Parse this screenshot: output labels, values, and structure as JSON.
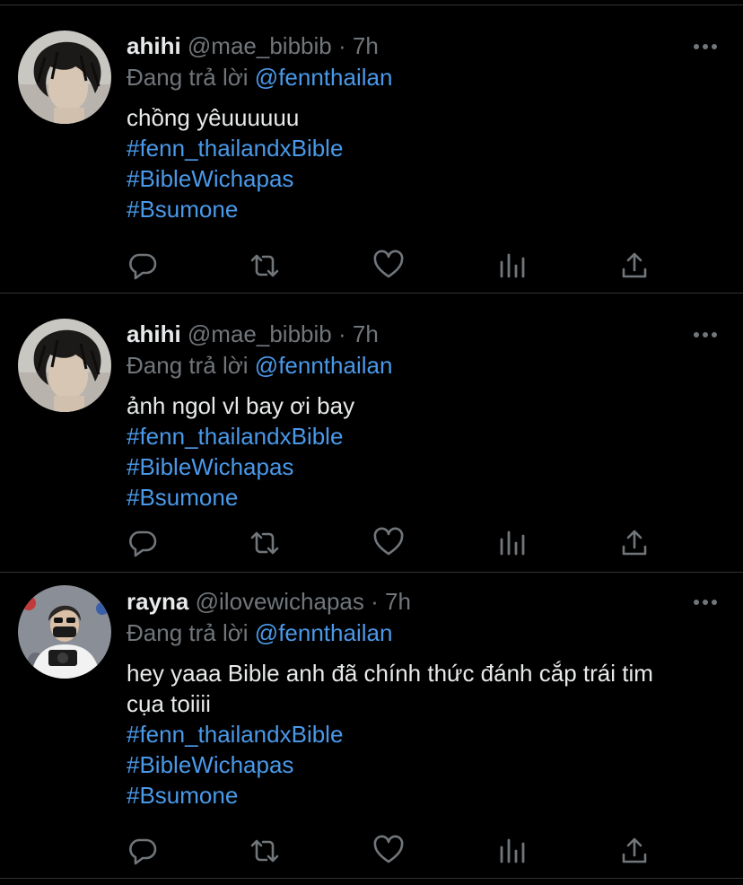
{
  "colors": {
    "background": "#000000",
    "divider": "#2f3336",
    "primary_text": "#e7e9ea",
    "secondary_text": "#71767b",
    "link": "#4a99e9"
  },
  "icons": {
    "more": "more-horizontal-icon",
    "reply": "reply-icon",
    "retweet": "retweet-icon",
    "like": "heart-icon",
    "views": "views-chart-icon",
    "share": "share-icon"
  },
  "tweets": [
    {
      "display_name": "ahihi",
      "handle": "@mae_bibbib",
      "separator": "·",
      "time": "7h",
      "replying_label": "Đang trả lời",
      "replying_to": "@fennthailan",
      "text": "chồng yêuuuuuu",
      "hashtags": [
        "#fenn_thailandxBible",
        "#BibleWichapas",
        "#Bsumone"
      ]
    },
    {
      "display_name": "ahihi",
      "handle": "@mae_bibbib",
      "separator": "·",
      "time": "7h",
      "replying_label": "Đang trả lời",
      "replying_to": "@fennthailan",
      "text": "ảnh ngol vl bay ơi bay",
      "hashtags": [
        "#fenn_thailandxBible",
        "#BibleWichapas",
        "#Bsumone"
      ]
    },
    {
      "display_name": "rayna",
      "handle": "@ilovewichapas",
      "separator": "·",
      "time": "7h",
      "replying_label": "Đang trả lời",
      "replying_to": "@fennthailan",
      "text": "hey yaaa Bible anh đã chính thức đánh cắp trái tim cụa toiiii",
      "hashtags": [
        "#fenn_thailandxBible",
        "#BibleWichapas",
        "#Bsumone"
      ]
    }
  ]
}
